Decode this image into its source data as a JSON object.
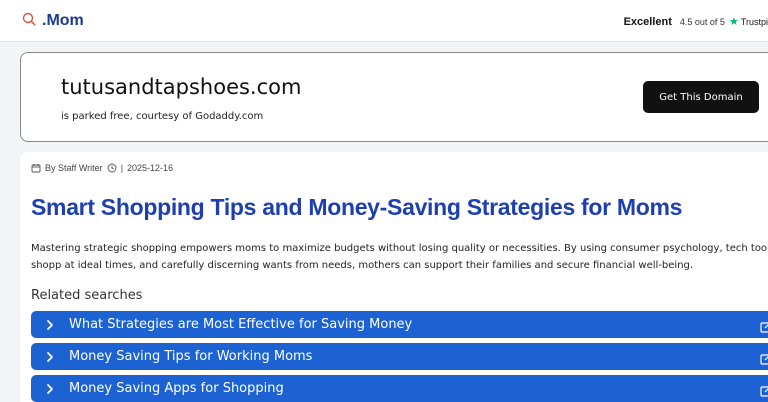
{
  "header": {
    "logo_text": ".Mom",
    "rating_label": "Excellent",
    "rating_score": "4.5 out of 5",
    "rating_brand": "Trustpi",
    "accent_color": "#00b67a"
  },
  "domain_banner": {
    "domain": "tutusandtapshoes.com",
    "subtitle": "is parked free, courtesy of Godaddy.com",
    "button_label": "Get This Domain"
  },
  "article": {
    "author": "By Staff Writer",
    "separator": "|",
    "date": "2025-12-16",
    "title": "Smart Shopping Tips and Money-Saving Strategies for Moms",
    "body": "Mastering strategic shopping empowers moms to maximize budgets without losing quality or necessities. By using consumer psychology, tech tools, shopp at ideal times, and carefully discerning wants from needs, mothers can support their families and secure financial well-being.",
    "title_color": "#1e40af"
  },
  "related": {
    "heading": "Related searches",
    "items": [
      {
        "label": "What Strategies are Most Effective for Saving Money"
      },
      {
        "label": "Money Saving Tips for Working Moms"
      },
      {
        "label": "Money Saving Apps for Shopping"
      }
    ],
    "item_color": "#1d62d3"
  }
}
